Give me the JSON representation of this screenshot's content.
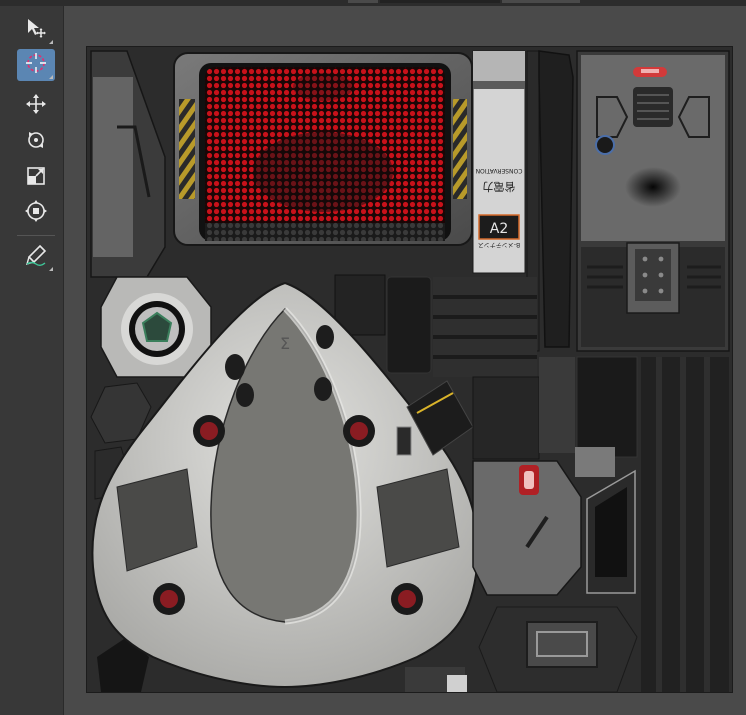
{
  "toolbar": {
    "tools": [
      {
        "icon": "select-move-icon",
        "active": false
      },
      {
        "icon": "target-select-icon",
        "active": true
      },
      {
        "icon": "move-icon",
        "active": false
      },
      {
        "icon": "rotate-icon",
        "active": false
      },
      {
        "icon": "scale-icon",
        "active": false
      },
      {
        "icon": "transform-icon",
        "active": false
      },
      {
        "icon": "brush-icon",
        "active": false
      }
    ]
  },
  "texture": {
    "panel_text_label": "A2",
    "panel_text_small_1": "CONSERVATION",
    "panel_text_small_2": "省電力",
    "panel_text_small_3": "B-メンテナンス",
    "sigma_glyph": "Σ"
  },
  "colors": {
    "active_tool": "#5b86b3",
    "viewport_bg": "#4a4a4a",
    "toolbar_bg": "#383838",
    "led_red": "#d0101a",
    "hull_white": "#d8d8d5"
  }
}
